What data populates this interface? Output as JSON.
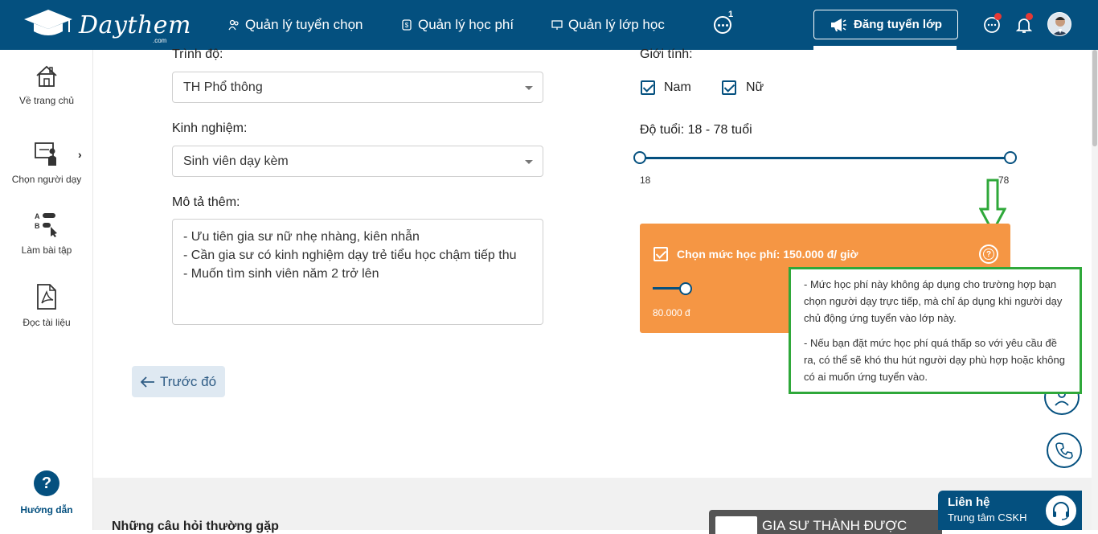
{
  "brand": {
    "logo_text": "Daythem",
    "logo_sub": ".com"
  },
  "nav": {
    "items": [
      {
        "label": "Quản lý tuyển chọn",
        "icon": "users-icon"
      },
      {
        "label": "Quản lý học phí",
        "icon": "money-icon"
      },
      {
        "label": "Quản lý lớp học",
        "icon": "board-icon"
      }
    ],
    "more_count": "1",
    "post_button": "Đăng tuyển lớp"
  },
  "sidebar": {
    "items": [
      {
        "label": "Về trang chủ",
        "icon": "home-icon"
      },
      {
        "label": "Chọn người dạy",
        "icon": "teacher-icon"
      },
      {
        "label": "Làm bài tập",
        "icon": "quiz-icon"
      },
      {
        "label": "Đọc tài liệu",
        "icon": "pdf-icon"
      }
    ],
    "help": {
      "icon_text": "?",
      "label": "Hướng dẫn"
    }
  },
  "form": {
    "level_label": "Trình độ:",
    "level_value": "TH Phổ thông",
    "experience_label": "Kinh nghiệm:",
    "experience_value": "Sinh viên dạy kèm",
    "desc_label": "Mô tả thêm:",
    "desc_value": "- Ưu tiên gia sư nữ nhẹ nhàng, kiên nhẫn\n- Cần gia sư có kinh nghiệm dạy trẻ tiểu học chậm tiếp thu\n- Muốn tìm sinh viên năm 2 trở lên",
    "prev_button": "Trước đó",
    "gender_label": "Giới tính:",
    "gender_male": "Nam",
    "gender_female": "Nữ",
    "age_label": "Độ tuổi:",
    "age_value": "18 - 78 tuổi",
    "age_min": "18",
    "age_max": "78"
  },
  "fee": {
    "title_prefix": "Chọn mức học phí:",
    "title_value": "150.000 đ/ giờ",
    "min_label": "80.000 đ",
    "help_icon": "?"
  },
  "tooltip": {
    "p1": "- Mức học phí này không áp dụng cho trường hợp bạn chọn người dạy trực tiếp, mà chỉ áp dụng khi người dạy chủ động ứng tuyển vào lớp này.",
    "p2": "- Nếu bạn đặt mức học phí quá thấp so với yêu cầu đề ra, có thể sẽ khó thu hút người dạy phù hợp hoặc không có ai muốn ứng tuyển vào."
  },
  "footer": {
    "faq": "Những câu hỏi thường gặp",
    "promo": "GIA SƯ THÀNH ĐƯỢC",
    "contact_title": "Liên hệ",
    "contact_sub": "Trung tâm CSKH"
  },
  "colors": {
    "primary": "#04507f",
    "fee_bg": "#f59644",
    "highlight": "#2fa83a"
  }
}
